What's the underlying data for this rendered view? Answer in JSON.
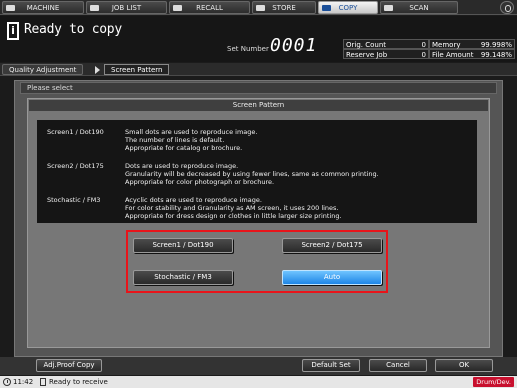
{
  "tabs": [
    {
      "label": "MACHINE"
    },
    {
      "label": "JOB LIST"
    },
    {
      "label": "RECALL"
    },
    {
      "label": "STORE"
    },
    {
      "label": "COPY"
    },
    {
      "label": "SCAN"
    }
  ],
  "status": {
    "message": "Ready to copy",
    "set_number_label": "Set Number",
    "set_number_value": "0001"
  },
  "counters": {
    "orig_count_label": "Orig. Count",
    "orig_count_value": "0",
    "reserve_job_label": "Reserve Job",
    "reserve_job_value": "0",
    "memory_label": "Memory",
    "memory_value": "99.998%",
    "file_amount_label": "File Amount",
    "file_amount_value": "99.148%"
  },
  "breadcrumb": {
    "parent": "Quality Adjustment",
    "current": "Screen Pattern"
  },
  "dialog": {
    "prompt": "Please select",
    "title": "Screen Pattern",
    "descriptions": [
      {
        "label": "Screen1 / Dot190",
        "lines": [
          "Small dots are used to reproduce image.",
          "The number of lines is default.",
          "Appropriate for catalog or brochure."
        ]
      },
      {
        "label": "Screen2 / Dot175",
        "lines": [
          "Dots are used to reproduce image.",
          "Granularity will be decreased by using fewer lines, same as common printing.",
          "Appropriate for color photograph or brochure."
        ]
      },
      {
        "label": "Stochastic / FM3",
        "lines": [
          "Acyclic dots are used to reproduce image.",
          "For color stability and Granularity as AM screen, it uses 200 lines.",
          "Appropriate for dress design or clothes in little larger size printing."
        ]
      }
    ],
    "options": {
      "screen1": "Screen1 / Dot190",
      "screen2": "Screen2 / Dot175",
      "stochastic": "Stochastic / FM3",
      "auto": "Auto"
    },
    "selected": "Auto"
  },
  "bottom": {
    "adj_proof_copy": "Adj.Proof Copy",
    "default_set": "Default Set",
    "cancel": "Cancel",
    "ok": "OK"
  },
  "footer": {
    "time": "11:42",
    "status": "Ready to receive",
    "drum": "Drum/Dev."
  },
  "colors": {
    "selected_button": "#1e86e6",
    "highlight_frame": "#e8141a",
    "drum_badge": "#c8102e"
  },
  "icons": [
    "machine-icon",
    "job-list-icon",
    "recall-icon",
    "store-icon",
    "copy-icon",
    "scan-icon",
    "power-icon",
    "info-icon",
    "clock-icon"
  ]
}
